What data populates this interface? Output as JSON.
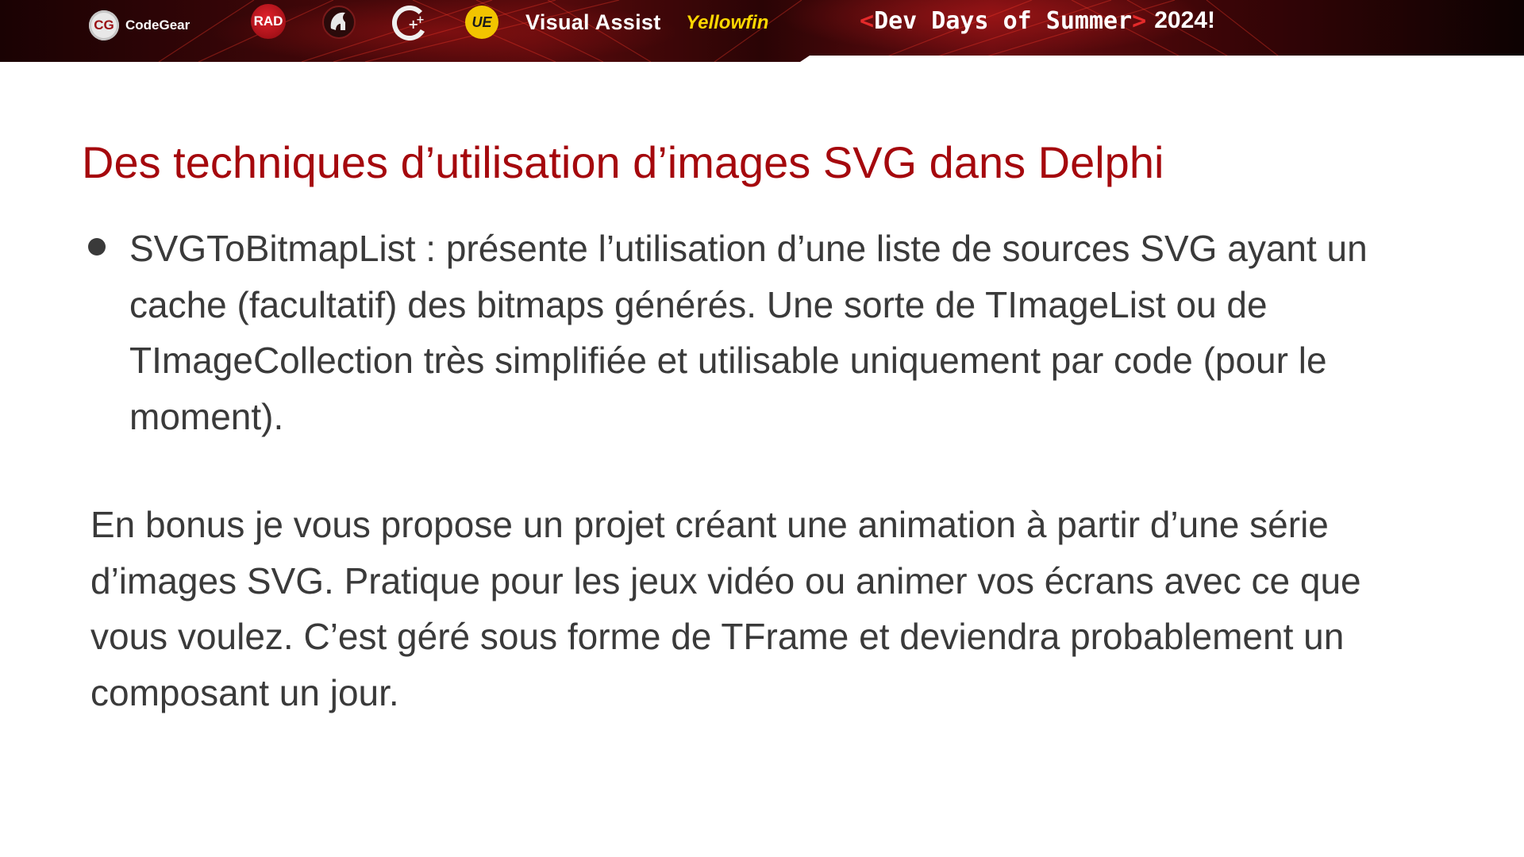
{
  "banner": {
    "codegear_badge": "CG",
    "codegear_label": "CodeGear",
    "rad_label": "RAD",
    "cpp_label": "C++",
    "ue_label": "UE",
    "visual_assist_label": "Visual Assist",
    "yellowfin_label": "Yellowfin",
    "event": {
      "open_bracket": "<",
      "name": "Dev Days of Summer",
      "close_bracket": ">",
      "year": "2024!"
    },
    "colors": {
      "accent": "#a5080d",
      "bracket": "#e42a2a",
      "yellow": "#ffd800"
    }
  },
  "slide": {
    "title": "Des techniques d’utilisation d’images SVG dans Delphi",
    "bullet": "SVGToBitmapList : présente l’utilisation d’une liste de sources SVG ayant un cache (facultatif) des bitmaps générés. Une sorte de TImageList ou de TImageCollection très simplifiée et utilisable uniquement par code (pour le moment).",
    "bonus": "En bonus je vous propose un projet créant une animation à partir d’une série d’images SVG. Pratique pour les jeux vidéo ou animer vos écrans avec ce que vous voulez. C’est géré sous forme de TFrame et deviendra probablement un composant un jour."
  }
}
